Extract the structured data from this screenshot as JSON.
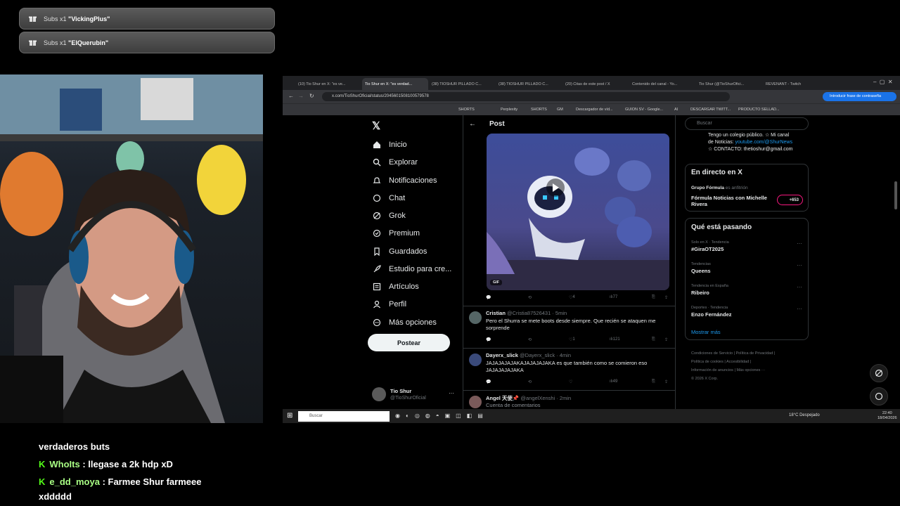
{
  "alerts": [
    {
      "prefix": "Subs x1",
      "name": "\"VickingPlus\""
    },
    {
      "prefix": "Subs x1",
      "name": "\"ElQuerubin\""
    }
  ],
  "chat": [
    {
      "user": "",
      "text": "verdaderos buts"
    },
    {
      "user": "WhoIts",
      "text": ": llegase a 2k hdp xD"
    },
    {
      "user": "e_dd_moya",
      "text": ": Farmee Shur farmeee"
    },
    {
      "user": "",
      "text": "xddddd"
    }
  ],
  "browser": {
    "tabs": [
      "(10) Tio Shur en X: \"es ve...",
      "Tio Shur en X: \"es verdad...",
      "(38) TIOSHUR PILLADO C...",
      "(38) TIOSHUR PILLADO C...",
      "(20) Citas de este post / X",
      "Contenido del canal - Yo...",
      "Tio Shur (@TioShurOfici...",
      "REVENANT - Twitch"
    ],
    "url": "x.com/TioShurOficial/status/2045601508100579578",
    "password_prompt": "Introducir frase de contraseña",
    "bookmarks": [
      "SHORTS",
      "Perplexity",
      "SHORTS",
      "GM",
      "Descargador de víd...",
      "GUION SV - Google...",
      "AI",
      "DESCARGAR TWITT...",
      "PRODUCTO SELLAD..."
    ]
  },
  "x": {
    "nav": [
      "Inicio",
      "Explorar",
      "Notificaciones",
      "Chat",
      "Grok",
      "Premium",
      "Guardados",
      "Estudio para cre...",
      "Artículos",
      "Perfil",
      "Más opciones"
    ],
    "post_button": "Postear",
    "account": {
      "name": "Tio Shur",
      "handle": "@TioShurOficial"
    },
    "header": "Post",
    "gif_badge": "GIF",
    "post_stats": {
      "likes": "4",
      "views": "77"
    },
    "replies": [
      {
        "name": "Cristian",
        "meta": "@Cristia87526431 · 5min",
        "text": "Pero el Shurra se mete boots desde siempre. Que recién se ataquen me sorprende",
        "likes": "1",
        "views": "121"
      },
      {
        "name": "Dayerx_slick",
        "meta": "@Dayerx_slick · 4min",
        "text": "JAJAJAJAJAKAJAJAJAJAKA es que también como se comieron eso JAJAJAJAJAKA",
        "likes": "",
        "views": "49"
      },
      {
        "name": "Angel 天使📌",
        "meta": "@angelXenshi · 2min",
        "text": "Cuenta de comentarios",
        "likes": "",
        "views": ""
      }
    ],
    "search_placeholder": "Buscar",
    "bio": [
      "Tengo un colegio público. ☆ Mi canal",
      "de Noticias: ",
      "youtube.com/@ShurNews",
      "☆ CONTACTO: thetioshur@gmail.com"
    ],
    "live": {
      "title": "En directo en X",
      "host": "Grupo Fórmula",
      "host_role": "es anfitrión",
      "show": "Fórmula Noticias con Michelle Rivera",
      "count": "+653"
    },
    "trending": {
      "title": "Qué está pasando",
      "items": [
        {
          "context": "Solo en X · Tendencia",
          "topic": "#GiraOT2025"
        },
        {
          "context": "Tendencias",
          "topic": "Queens"
        },
        {
          "context": "Tendencia en España",
          "topic": "Ribeiro"
        },
        {
          "context": "Deportes · Tendencia",
          "topic": "Enzo Fernández"
        }
      ],
      "more": "Mostrar más"
    },
    "footer": [
      "Condiciones de Servicio",
      "Política de Privacidad",
      "Política de cookies",
      "Accesibilidad",
      "Información de anuncios",
      "Más opciones ···",
      "© 2026 X Corp."
    ]
  },
  "taskbar": {
    "search": "Buscar",
    "weather": "18°C  Despejado",
    "time": "22:40",
    "date": "18/04/2026"
  }
}
